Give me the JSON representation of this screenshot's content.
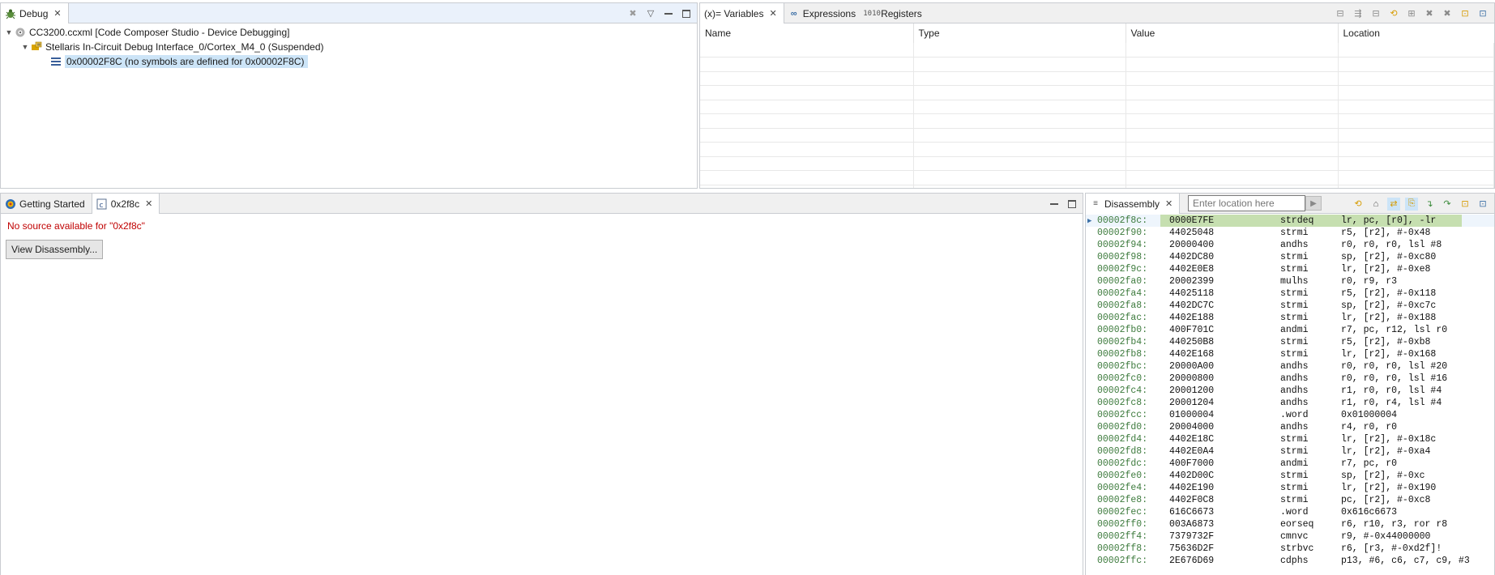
{
  "debug_view": {
    "tab_label": "Debug",
    "tree": [
      {
        "label": "CC3200.ccxml [Code Composer Studio - Device Debugging]"
      },
      {
        "label": "Stellaris In-Circuit Debug Interface_0/Cortex_M4_0 (Suspended)"
      },
      {
        "label": "0x00002F8C  (no symbols are defined for 0x00002F8C)"
      }
    ]
  },
  "variables_view": {
    "tabs": [
      {
        "label": "(x)= Variables"
      },
      {
        "label": "Expressions"
      },
      {
        "label": "Registers"
      }
    ],
    "columns": [
      "Name",
      "Type",
      "Value",
      "Location"
    ]
  },
  "editor": {
    "tabs": [
      {
        "label": "Getting Started"
      },
      {
        "label": "0x2f8c"
      }
    ],
    "no_source_message": "No source available for \"0x2f8c\"",
    "view_disassembly_label": "View Disassembly..."
  },
  "disassembly": {
    "tab_label": "Disassembly",
    "location_placeholder": "Enter location here",
    "rows": [
      {
        "addr": "00002f8c:",
        "opcode": "0000E7FE",
        "mnemonic": "strdeq",
        "args": "lr, pc, [r0], -lr"
      },
      {
        "addr": "00002f90:",
        "opcode": "44025048",
        "mnemonic": "strmi",
        "args": "r5, [r2], #-0x48"
      },
      {
        "addr": "00002f94:",
        "opcode": "20000400",
        "mnemonic": "andhs",
        "args": "r0, r0, r0, lsl #8"
      },
      {
        "addr": "00002f98:",
        "opcode": "4402DC80",
        "mnemonic": "strmi",
        "args": "sp, [r2], #-0xc80"
      },
      {
        "addr": "00002f9c:",
        "opcode": "4402E0E8",
        "mnemonic": "strmi",
        "args": "lr, [r2], #-0xe8"
      },
      {
        "addr": "00002fa0:",
        "opcode": "20002399",
        "mnemonic": "mulhs",
        "args": "r0, r9, r3"
      },
      {
        "addr": "00002fa4:",
        "opcode": "44025118",
        "mnemonic": "strmi",
        "args": "r5, [r2], #-0x118"
      },
      {
        "addr": "00002fa8:",
        "opcode": "4402DC7C",
        "mnemonic": "strmi",
        "args": "sp, [r2], #-0xc7c"
      },
      {
        "addr": "00002fac:",
        "opcode": "4402E188",
        "mnemonic": "strmi",
        "args": "lr, [r2], #-0x188"
      },
      {
        "addr": "00002fb0:",
        "opcode": "400F701C",
        "mnemonic": "andmi",
        "args": "r7, pc, r12, lsl r0"
      },
      {
        "addr": "00002fb4:",
        "opcode": "440250B8",
        "mnemonic": "strmi",
        "args": "r5, [r2], #-0xb8"
      },
      {
        "addr": "00002fb8:",
        "opcode": "4402E168",
        "mnemonic": "strmi",
        "args": "lr, [r2], #-0x168"
      },
      {
        "addr": "00002fbc:",
        "opcode": "20000A00",
        "mnemonic": "andhs",
        "args": "r0, r0, r0, lsl #20"
      },
      {
        "addr": "00002fc0:",
        "opcode": "20000800",
        "mnemonic": "andhs",
        "args": "r0, r0, r0, lsl #16"
      },
      {
        "addr": "00002fc4:",
        "opcode": "20001200",
        "mnemonic": "andhs",
        "args": "r1, r0, r0, lsl #4"
      },
      {
        "addr": "00002fc8:",
        "opcode": "20001204",
        "mnemonic": "andhs",
        "args": "r1, r0, r4, lsl #4"
      },
      {
        "addr": "00002fcc:",
        "opcode": "01000004",
        "mnemonic": ".word",
        "args": "0x01000004"
      },
      {
        "addr": "00002fd0:",
        "opcode": "20004000",
        "mnemonic": "andhs",
        "args": "r4, r0, r0"
      },
      {
        "addr": "00002fd4:",
        "opcode": "4402E18C",
        "mnemonic": "strmi",
        "args": "lr, [r2], #-0x18c"
      },
      {
        "addr": "00002fd8:",
        "opcode": "4402E0A4",
        "mnemonic": "strmi",
        "args": "lr, [r2], #-0xa4"
      },
      {
        "addr": "00002fdc:",
        "opcode": "400F7000",
        "mnemonic": "andmi",
        "args": "r7, pc, r0"
      },
      {
        "addr": "00002fe0:",
        "opcode": "4402D00C",
        "mnemonic": "strmi",
        "args": "sp, [r2], #-0xc"
      },
      {
        "addr": "00002fe4:",
        "opcode": "4402E190",
        "mnemonic": "strmi",
        "args": "lr, [r2], #-0x190"
      },
      {
        "addr": "00002fe8:",
        "opcode": "4402F0C8",
        "mnemonic": "strmi",
        "args": "pc, [r2], #-0xc8"
      },
      {
        "addr": "00002fec:",
        "opcode": "616C6673",
        "mnemonic": ".word",
        "args": "0x616c6673"
      },
      {
        "addr": "00002ff0:",
        "opcode": "003A6873",
        "mnemonic": "eorseq",
        "args": "r6, r10, r3, ror r8"
      },
      {
        "addr": "00002ff4:",
        "opcode": "7379732F",
        "mnemonic": "cmnvc",
        "args": "r9, #-0x44000000"
      },
      {
        "addr": "00002ff8:",
        "opcode": "75636D2F",
        "mnemonic": "strbvc",
        "args": "r6, [r3, #-0xd2f]!"
      },
      {
        "addr": "00002ffc:",
        "opcode": "2E676D69",
        "mnemonic": "cdphs",
        "args": "p13, #6, c6, c7, c9, #3"
      }
    ]
  }
}
